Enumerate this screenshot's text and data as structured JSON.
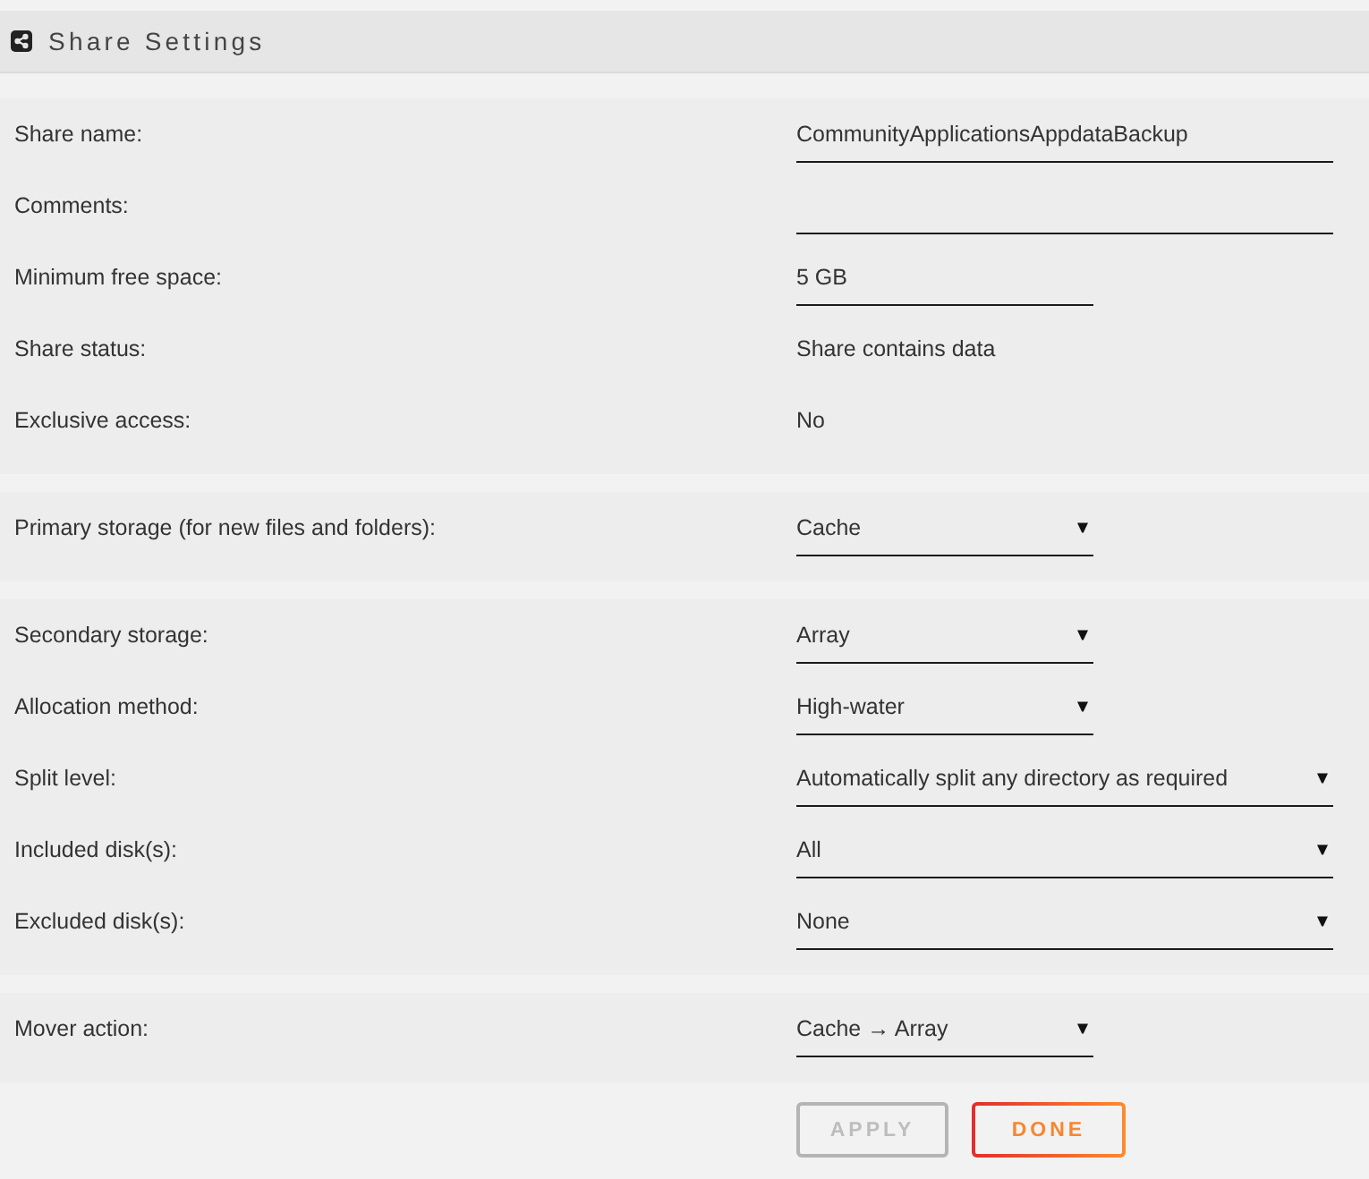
{
  "header": {
    "title": "Share Settings"
  },
  "sections": [
    {
      "rows": [
        {
          "label": "Share name:",
          "kind": "input",
          "value": "CommunityApplicationsAppdataBackup"
        },
        {
          "label": "Comments:",
          "kind": "input"
        },
        {
          "label": "Minimum free space:",
          "kind": "input",
          "value": "5 GB"
        },
        {
          "label": "Share status:",
          "kind": "static",
          "value": "Share contains data"
        },
        {
          "label": "Exclusive access:",
          "kind": "static",
          "value": "No"
        }
      ]
    },
    {
      "rows": [
        {
          "label": "Primary storage (for new files and folders):",
          "kind": "select",
          "value": "Cache"
        }
      ]
    },
    {
      "rows": [
        {
          "label": "Secondary storage:",
          "kind": "select",
          "value": "Array"
        },
        {
          "label": "Allocation method:",
          "kind": "select",
          "value": "High-water"
        },
        {
          "label": "Split level:",
          "kind": "select",
          "value": "Automatically split any directory as required"
        },
        {
          "label": "Included disk(s):",
          "kind": "select",
          "value": "All"
        },
        {
          "label": "Excluded disk(s):",
          "kind": "select",
          "value": "None"
        }
      ]
    },
    {
      "rows": [
        {
          "label": "Mover action:",
          "kind": "select",
          "value": "Cache → Array"
        }
      ]
    }
  ],
  "buttons": [
    {
      "label": "APPLY",
      "disabled": true
    },
    {
      "label": "DONE",
      "disabled": false
    }
  ]
}
